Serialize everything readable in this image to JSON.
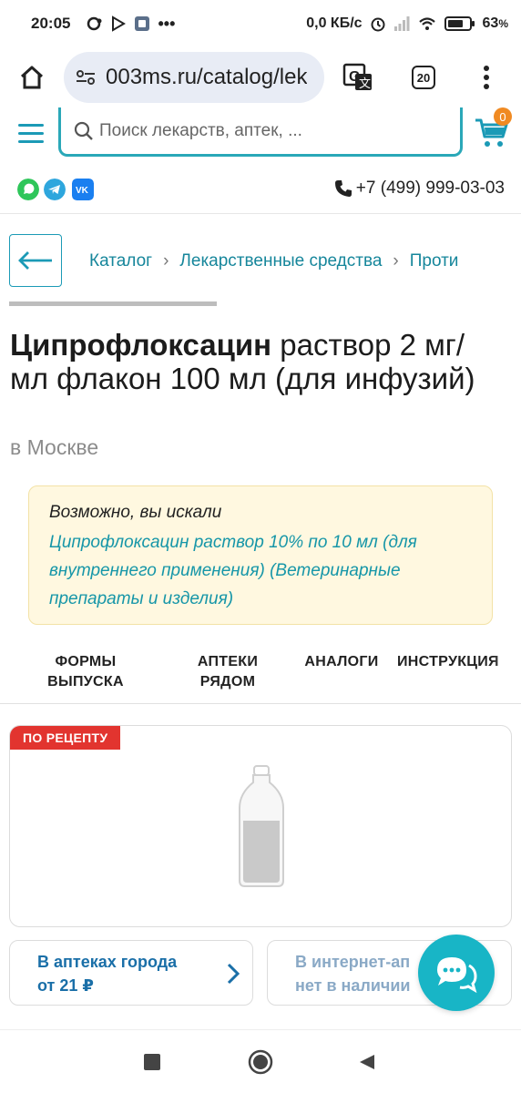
{
  "status_bar": {
    "time": "20:05",
    "net_speed": "0,0 КБ/с",
    "battery": "63"
  },
  "browser": {
    "url": "003ms.ru/catalog/lek",
    "tabs_count": "20"
  },
  "header": {
    "search_placeholder": "Поиск лекарств, аптек, ...",
    "cart_count": "0",
    "phone": "+7 (499) 999-03-03"
  },
  "breadcrumbs": [
    "Каталог",
    "Лекарственные средства",
    "Проти"
  ],
  "product": {
    "name_bold": "Ципрофлоксацин",
    "name_rest": " раствор 2 мг/мл флакон 100 мл (для инфузий)",
    "city": "в Москве",
    "rx_badge": "ПО РЕЦЕПТУ"
  },
  "suggestion": {
    "heading": "Возможно, вы искали",
    "link": "Ципрофлоксацин раствор 10% по 10 мл (для внутреннего применения) (Ветеринарные препараты и изделия)"
  },
  "tabs": [
    {
      "line1": "ФОРМЫ",
      "line2": "ВЫПУСКА"
    },
    {
      "line1": "АПТЕКИ",
      "line2": "РЯДОМ"
    },
    {
      "line1": "АНАЛОГИ",
      "line2": ""
    },
    {
      "line1": "ИНСТРУКЦИЯ",
      "line2": ""
    }
  ],
  "availability": {
    "city_title": "В аптеках города",
    "city_price": "от 21 ₽",
    "online_title": "В интернет-ап",
    "online_status": "нет в наличии"
  },
  "colors": {
    "accent": "#1b9ab6",
    "link": "#16869b",
    "badge_red": "#e2342f",
    "cart_badge": "#f08a22",
    "suggestion_bg": "#fff8e0"
  }
}
